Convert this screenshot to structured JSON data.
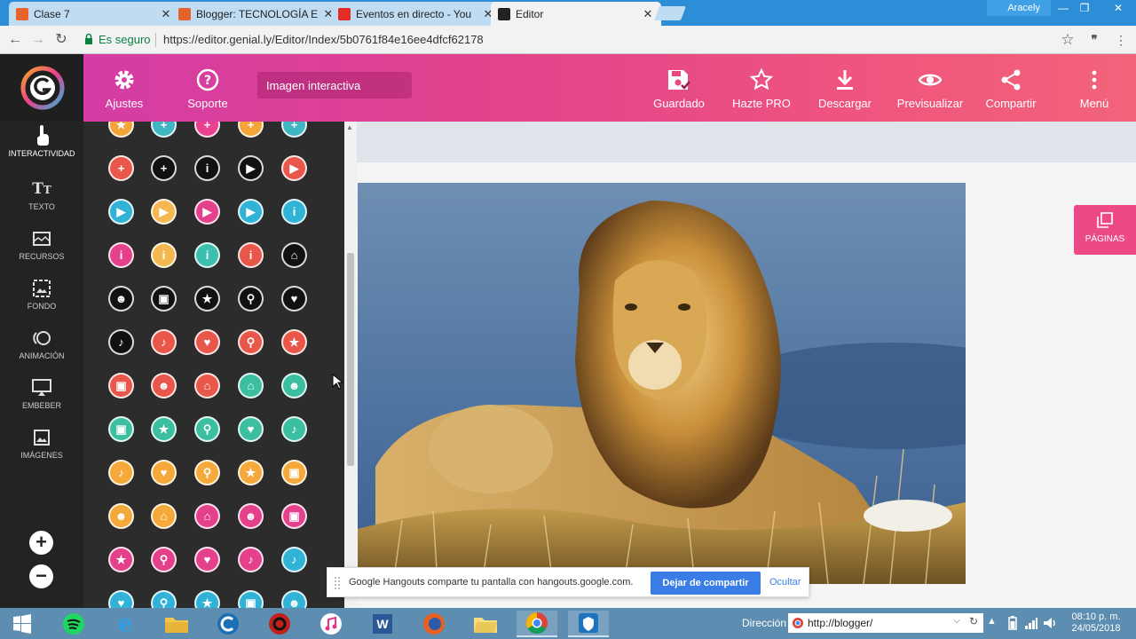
{
  "browser": {
    "tabs": [
      {
        "title": "Clase 7",
        "favicon_color": "#e8632a",
        "active": false
      },
      {
        "title": "Blogger: TECNOLOGÍA E",
        "favicon_color": "#e8632a",
        "active": false
      },
      {
        "title": "Eventos en directo - You",
        "favicon_color": "#e52d27",
        "active": false
      },
      {
        "title": "Editor",
        "favicon_color": "#222222",
        "active": true
      }
    ],
    "profile_name": "Aracely",
    "secure_label": "Es seguro",
    "url": "https://editor.genial.ly/Editor/Index/5b0761f84e16ee4dfcf62178"
  },
  "header": {
    "settings_label": "Ajustes",
    "support_label": "Soporte",
    "mode_label": "Imagen interactiva",
    "saved_label": "Guardado",
    "pro_label": "Hazte PRO",
    "download_label": "Descargar",
    "preview_label": "Previsualizar",
    "share_label": "Compartir",
    "menu_label": "Menú"
  },
  "sidebar": {
    "items": [
      {
        "label": "INTERACTIVIDAD",
        "icon": "hand-pointer-icon"
      },
      {
        "label": "TEXTO",
        "icon": "text-icon"
      },
      {
        "label": "RECURSOS",
        "icon": "resources-icon"
      },
      {
        "label": "FONDO",
        "icon": "background-icon"
      },
      {
        "label": "ANIMACIÓN",
        "icon": "animation-icon"
      },
      {
        "label": "EMBEBER",
        "icon": "embed-icon"
      },
      {
        "label": "IMÁGENES",
        "icon": "images-icon"
      }
    ],
    "zoom_in": "+",
    "zoom_out": "−"
  },
  "icon_panel": {
    "rows": [
      [
        {
          "icon": "star",
          "bg": "#f3a53a",
          "fg": "#fff"
        },
        {
          "icon": "plus",
          "bg": "#3fb6c2",
          "fg": "#fff"
        },
        {
          "icon": "plus",
          "bg": "#e9408f",
          "fg": "#fff"
        },
        {
          "icon": "plus",
          "bg": "#f3a53a",
          "fg": "#fff"
        },
        {
          "icon": "plus",
          "bg": "#3fb6c2",
          "fg": "#fff"
        }
      ],
      [
        {
          "icon": "plus",
          "bg": "#e9574a",
          "fg": "#fff"
        },
        {
          "icon": "plus",
          "bg": "#111",
          "fg": "#fff"
        },
        {
          "icon": "info",
          "bg": "#111",
          "fg": "#fff"
        },
        {
          "icon": "play",
          "bg": "#111",
          "fg": "#fff"
        },
        {
          "icon": "play",
          "bg": "#e9574a",
          "fg": "#fff"
        }
      ],
      [
        {
          "icon": "play",
          "bg": "#31b3d8",
          "fg": "#fff"
        },
        {
          "icon": "play",
          "bg": "#f5b850",
          "fg": "#fff"
        },
        {
          "icon": "play",
          "bg": "#e5408c",
          "fg": "#fff"
        },
        {
          "icon": "play",
          "bg": "#31b3d8",
          "fg": "#fff"
        },
        {
          "icon": "info",
          "bg": "#31b3d8",
          "fg": "#fff"
        }
      ],
      [
        {
          "icon": "info",
          "bg": "#e5408c",
          "fg": "#fff"
        },
        {
          "icon": "info",
          "bg": "#f5b850",
          "fg": "#fff"
        },
        {
          "icon": "info",
          "bg": "#3cbfb0",
          "fg": "#fff"
        },
        {
          "icon": "info",
          "bg": "#e9574a",
          "fg": "#fff"
        },
        {
          "icon": "home",
          "bg": "#111",
          "fg": "#fff"
        }
      ],
      [
        {
          "icon": "people",
          "bg": "#111",
          "fg": "#fff"
        },
        {
          "icon": "image",
          "bg": "#111",
          "fg": "#fff"
        },
        {
          "icon": "star",
          "bg": "#111",
          "fg": "#fff"
        },
        {
          "icon": "search",
          "bg": "#111",
          "fg": "#fff"
        },
        {
          "icon": "heart",
          "bg": "#111",
          "fg": "#fff"
        }
      ],
      [
        {
          "icon": "sound",
          "bg": "#111",
          "fg": "#fff"
        },
        {
          "icon": "sound",
          "bg": "#e9574a",
          "fg": "#fff"
        },
        {
          "icon": "heart",
          "bg": "#e9574a",
          "fg": "#fff"
        },
        {
          "icon": "search",
          "bg": "#e9574a",
          "fg": "#fff"
        },
        {
          "icon": "star",
          "bg": "#e9574a",
          "fg": "#fff"
        }
      ],
      [
        {
          "icon": "image",
          "bg": "#e9574a",
          "fg": "#fff"
        },
        {
          "icon": "people",
          "bg": "#e9574a",
          "fg": "#fff"
        },
        {
          "icon": "home",
          "bg": "#e9574a",
          "fg": "#fff"
        },
        {
          "icon": "home",
          "bg": "#3cbfa0",
          "fg": "#fff"
        },
        {
          "icon": "people",
          "bg": "#3cbfa0",
          "fg": "#fff"
        }
      ],
      [
        {
          "icon": "image",
          "bg": "#3cbfa0",
          "fg": "#fff"
        },
        {
          "icon": "star",
          "bg": "#3cbfa0",
          "fg": "#fff"
        },
        {
          "icon": "search",
          "bg": "#3cbfa0",
          "fg": "#fff"
        },
        {
          "icon": "heart",
          "bg": "#3cbfa0",
          "fg": "#fff"
        },
        {
          "icon": "sound",
          "bg": "#3cbfa0",
          "fg": "#fff"
        }
      ],
      [
        {
          "icon": "sound",
          "bg": "#f5a93a",
          "fg": "#fff"
        },
        {
          "icon": "heart",
          "bg": "#f5a93a",
          "fg": "#fff"
        },
        {
          "icon": "search",
          "bg": "#f5a93a",
          "fg": "#fff"
        },
        {
          "icon": "star",
          "bg": "#f5a93a",
          "fg": "#fff"
        },
        {
          "icon": "image",
          "bg": "#f5a93a",
          "fg": "#fff"
        }
      ],
      [
        {
          "icon": "people",
          "bg": "#f5a93a",
          "fg": "#fff"
        },
        {
          "icon": "home",
          "bg": "#f5a93a",
          "fg": "#fff"
        },
        {
          "icon": "home",
          "bg": "#e5408c",
          "fg": "#fff"
        },
        {
          "icon": "people",
          "bg": "#e5408c",
          "fg": "#fff"
        },
        {
          "icon": "image",
          "bg": "#e5408c",
          "fg": "#fff"
        }
      ],
      [
        {
          "icon": "star",
          "bg": "#e5408c",
          "fg": "#fff"
        },
        {
          "icon": "search",
          "bg": "#e5408c",
          "fg": "#fff"
        },
        {
          "icon": "heart",
          "bg": "#e5408c",
          "fg": "#fff"
        },
        {
          "icon": "sound",
          "bg": "#e5408c",
          "fg": "#fff"
        },
        {
          "icon": "sound",
          "bg": "#31b3d8",
          "fg": "#fff"
        }
      ],
      [
        {
          "icon": "heart",
          "bg": "#31b3d8",
          "fg": "#fff"
        },
        {
          "icon": "search",
          "bg": "#31b3d8",
          "fg": "#fff"
        },
        {
          "icon": "star",
          "bg": "#31b3d8",
          "fg": "#fff"
        },
        {
          "icon": "image",
          "bg": "#31b3d8",
          "fg": "#fff"
        },
        {
          "icon": "people",
          "bg": "#31b3d8",
          "fg": "#fff"
        }
      ]
    ]
  },
  "canvas": {
    "pages_label": "PÁGINAS",
    "image_subject": "lion"
  },
  "share_notice": {
    "message": "Google Hangouts comparte tu pantalla con hangouts.google.com.",
    "stop_label": "Dejar de compartir",
    "hide_label": "Ocultar"
  },
  "taskbar": {
    "address_label": "Dirección",
    "address_value": "http://blogger/",
    "time": "08:10 p. m.",
    "date": "24/05/2018"
  }
}
